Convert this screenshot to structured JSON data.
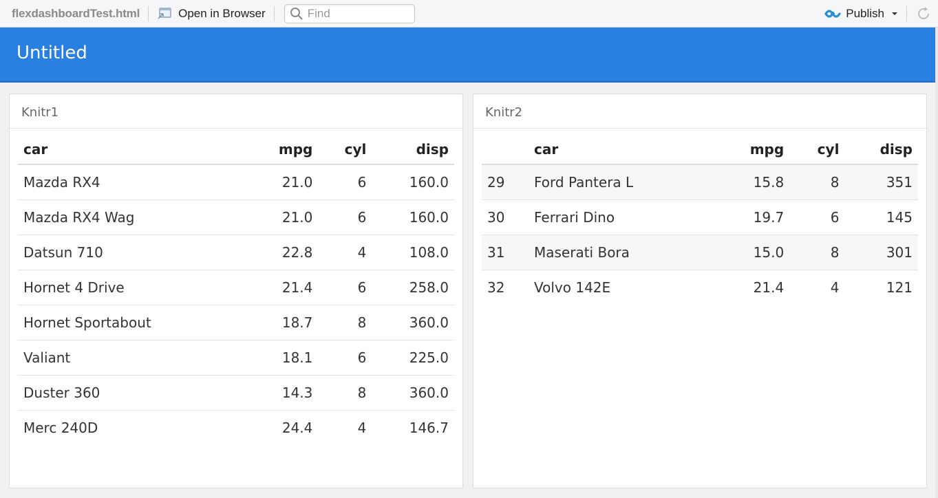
{
  "toolbar": {
    "filename": "flexdashboardTest.html",
    "open_in_browser_label": "Open in Browser",
    "find_placeholder": "Find",
    "publish_label": "Publish"
  },
  "dashboard": {
    "title": "Untitled"
  },
  "panels": [
    {
      "title": "Knitr1",
      "columns": [
        "car",
        "mpg",
        "cyl",
        "disp"
      ],
      "rows": [
        {
          "car": "Mazda RX4",
          "mpg": "21.0",
          "cyl": "6",
          "disp": "160.0"
        },
        {
          "car": "Mazda RX4 Wag",
          "mpg": "21.0",
          "cyl": "6",
          "disp": "160.0"
        },
        {
          "car": "Datsun 710",
          "mpg": "22.8",
          "cyl": "4",
          "disp": "108.0"
        },
        {
          "car": "Hornet 4 Drive",
          "mpg": "21.4",
          "cyl": "6",
          "disp": "258.0"
        },
        {
          "car": "Hornet Sportabout",
          "mpg": "18.7",
          "cyl": "8",
          "disp": "360.0"
        },
        {
          "car": "Valiant",
          "mpg": "18.1",
          "cyl": "6",
          "disp": "225.0"
        },
        {
          "car": "Duster 360",
          "mpg": "14.3",
          "cyl": "8",
          "disp": "360.0"
        },
        {
          "car": "Merc 240D",
          "mpg": "24.4",
          "cyl": "4",
          "disp": "146.7"
        }
      ]
    },
    {
      "title": "Knitr2",
      "columns": [
        "",
        "car",
        "mpg",
        "cyl",
        "disp"
      ],
      "rows": [
        {
          "idx": "29",
          "car": "Ford Pantera L",
          "mpg": "15.8",
          "cyl": "8",
          "disp": "351"
        },
        {
          "idx": "30",
          "car": "Ferrari Dino",
          "mpg": "19.7",
          "cyl": "6",
          "disp": "145"
        },
        {
          "idx": "31",
          "car": "Maserati Bora",
          "mpg": "15.0",
          "cyl": "8",
          "disp": "301"
        },
        {
          "idx": "32",
          "car": "Volvo 142E",
          "mpg": "21.4",
          "cyl": "4",
          "disp": "121"
        }
      ]
    }
  ],
  "colors": {
    "navbar": "#2a80e0",
    "publish_icon": "#2a8fd6"
  },
  "icons": [
    "open-in-browser-icon",
    "search-icon",
    "publish-icon",
    "chevron-down-icon",
    "refresh-icon"
  ]
}
